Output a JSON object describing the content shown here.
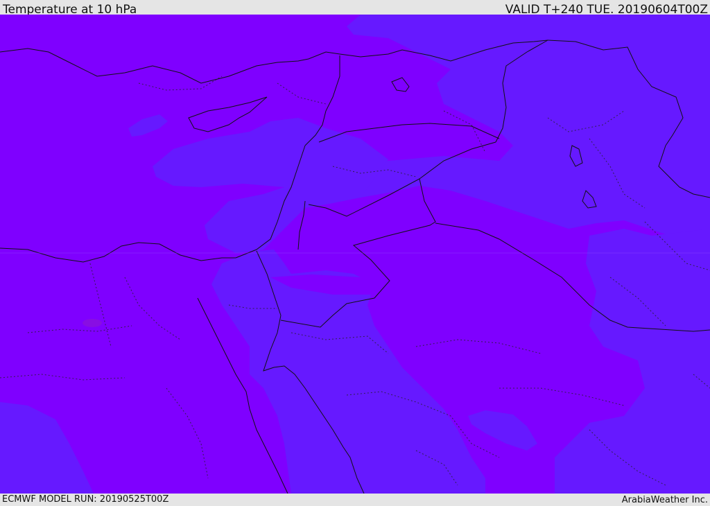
{
  "header": {
    "title": "Temperature at 10 hPa",
    "valid": "VALID T+240 TUE. 20190604T00Z"
  },
  "footer": {
    "model_run": "ECMWF MODEL RUN: 20190525T00Z",
    "credit": "ArabiaWeather Inc."
  },
  "map": {
    "colors": {
      "warm_band": "#7f00ff",
      "cool_band": "#6619ff",
      "spot": "#8a10e0",
      "coast": "#111111"
    }
  }
}
